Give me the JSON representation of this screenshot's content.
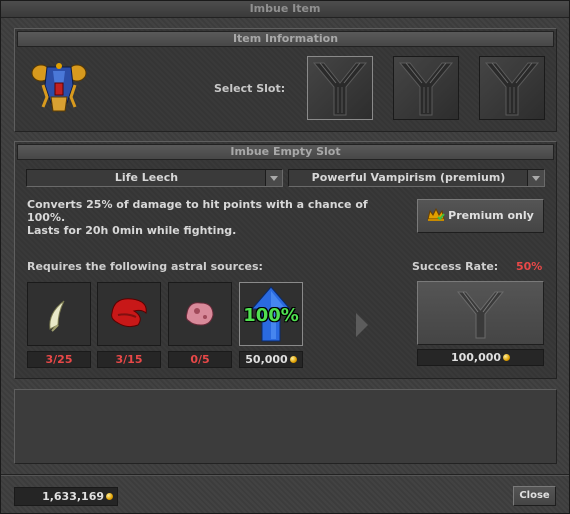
{
  "window": {
    "title": "Imbue Item"
  },
  "item_info": {
    "header": "Item Information",
    "select_slot_label": "Select Slot:",
    "item_icon": "armor-icon",
    "slots": [
      {
        "name": "slot-1",
        "selected": true
      },
      {
        "name": "slot-2",
        "selected": false
      },
      {
        "name": "slot-3",
        "selected": false
      }
    ]
  },
  "imbue": {
    "header": "Imbue Empty Slot",
    "type_value": "Life Leech",
    "level_value": "Powerful Vampirism (premium)",
    "description_line1": "Converts 25% of damage to hit points with a chance of",
    "description_line2": "100%.",
    "description_line3": "Lasts for 20h 0min while fighting.",
    "premium_label": "Premium only",
    "requires_label": "Requires the following astral sources:",
    "success_rate_label": "Success Rate:",
    "success_rate_value": "50%",
    "sources": [
      {
        "icon": "fang-icon",
        "count": "3/25"
      },
      {
        "icon": "red-claw-icon",
        "count": "3/15"
      },
      {
        "icon": "pink-flesh-icon",
        "count": "0/5"
      }
    ],
    "protection": {
      "icon": "blue-up-arrow-icon",
      "label": "100%",
      "cost": "50,000"
    },
    "result_cost": "100,000"
  },
  "footer": {
    "balance": "1,633,169",
    "close_label": "Close"
  },
  "colors": {
    "accent_red": "#e84848",
    "gold": "#e0a000"
  }
}
